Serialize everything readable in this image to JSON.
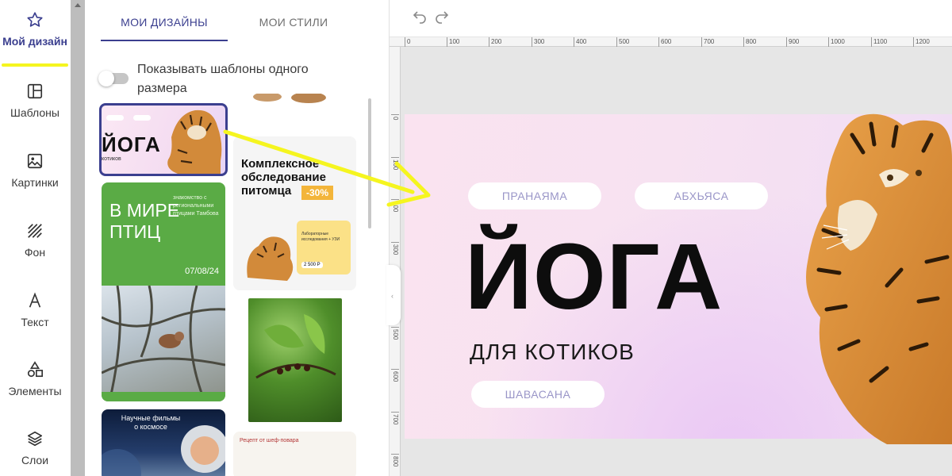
{
  "rail": {
    "items": [
      {
        "label": "Мой дизайн",
        "icon": "star-icon",
        "active": true
      },
      {
        "label": "Шаблоны",
        "icon": "template-icon",
        "active": false
      },
      {
        "label": "Картинки",
        "icon": "image-icon",
        "active": false
      },
      {
        "label": "Фон",
        "icon": "background-hatch-icon",
        "active": false
      },
      {
        "label": "Текст",
        "icon": "text-icon",
        "active": false
      },
      {
        "label": "Элементы",
        "icon": "shapes-icon",
        "active": false
      },
      {
        "label": "Слои",
        "icon": "layers-icon",
        "active": false
      }
    ],
    "highlight_color": "#f5f51f",
    "active_color": "#3b3f8f"
  },
  "panel": {
    "tabs": [
      {
        "label": "МОИ ДИЗАЙНЫ",
        "active": true
      },
      {
        "label": "МОИ СТИЛИ",
        "active": false
      }
    ],
    "toggle": {
      "label": "Показывать шаблоны одного размера",
      "checked": false
    },
    "thumbnails": {
      "yoga": {
        "title": "ЙОГА",
        "subtitle": "котиков"
      },
      "birds": {
        "title": "В МИРЕ ПТИЦ",
        "caption": "знакомство с региональными птицами Тамбова",
        "date": "07/08/24"
      },
      "vet": {
        "title": "Комплексное обследование питомца",
        "discount": "-30%",
        "card_text": "Лабораторные исследования + УЗИ",
        "price": "2 500 Р"
      },
      "space": {
        "caption": "Научные фильмы о космосе"
      },
      "recipe": {
        "caption": "Рецепт от шеф-повара"
      }
    }
  },
  "toolbar": {
    "undo_icon": "undo-icon",
    "redo_icon": "redo-icon"
  },
  "ruler": {
    "horizontal": [
      "0",
      "100",
      "200",
      "300",
      "400",
      "500",
      "600",
      "700",
      "800",
      "900",
      "1000",
      "1100",
      "1200"
    ],
    "vertical": [
      "0",
      "100",
      "200",
      "300",
      "400",
      "500",
      "600",
      "700",
      "800"
    ]
  },
  "slide": {
    "pills": [
      "ПРАНАЯМА",
      "АБХЬЯСА",
      "ШАВАСАНА"
    ],
    "headline": "ЙОГА",
    "subline": "ДЛЯ КОТИКОВ",
    "pill_text_color": "#9a96c8"
  },
  "annotation": {
    "arrow_color": "#f5f51f"
  }
}
